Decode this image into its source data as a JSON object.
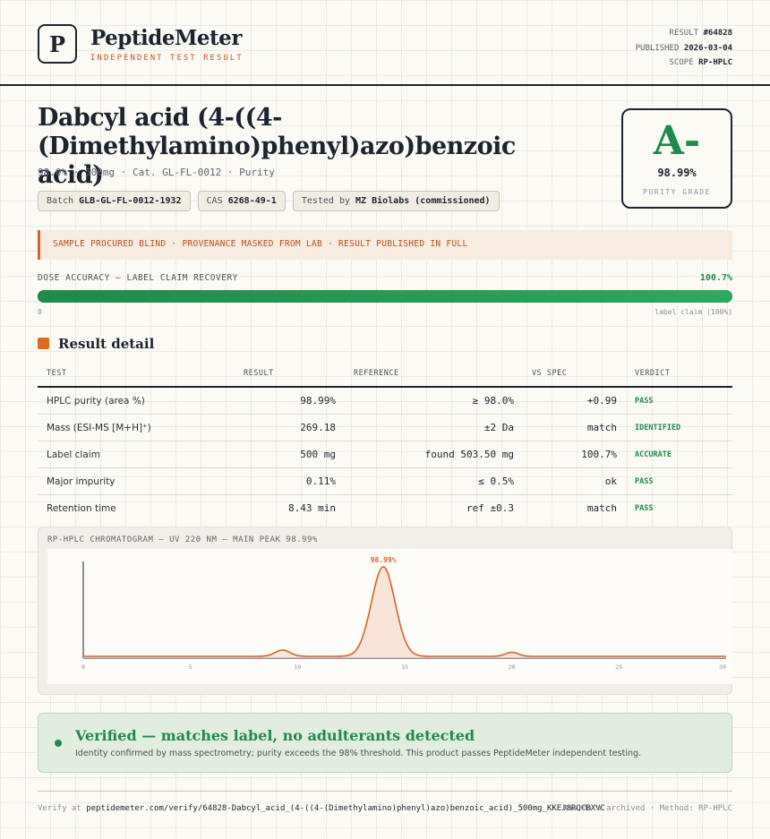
{
  "header": {
    "logo_letter": "P",
    "brand": "PeptideMeter",
    "tagline": "INDEPENDENT TEST RESULT",
    "result_label": "RESULT",
    "result_value": "#64828",
    "published_label": "PUBLISHED",
    "published_value": "2026-03-04",
    "scope_label": "SCOPE",
    "scope_value": "RP-HPLC"
  },
  "product": {
    "title": "Dabcyl acid (4-((4-(Dimethylamino)phenyl)azo)benzoic acid)",
    "subtitle": "98.0% · 500mg · Cat. GL-FL-0012 · Purity",
    "chips": [
      {
        "label": "Batch",
        "value": "GLB-GL-FL-0012-1932"
      },
      {
        "label": "CAS",
        "value": "6268-49-1"
      },
      {
        "label": "Tested by",
        "value": "MZ Biolabs (commissioned)"
      }
    ]
  },
  "grade": {
    "letter": "A-",
    "value": "98.99%",
    "label": "PURITY GRADE",
    "color": "#1f8a4a"
  },
  "notice": "SAMPLE PROCURED BLIND · PROVENANCE MASKED FROM LAB · RESULT PUBLISHED IN FULL",
  "dose": {
    "label": "DOSE ACCURACY — LABEL CLAIM RECOVERY",
    "value": "100.7%",
    "fill_fraction": 1.0,
    "min_label": "0",
    "max_label": "label claim (100%)"
  },
  "section_title": "Result detail",
  "table": {
    "headers": [
      "TEST",
      "RESULT",
      "REFERENCE",
      "VS SPEC",
      "VERDICT"
    ],
    "rows": [
      {
        "test": "HPLC purity (area %)",
        "result": "98.99%",
        "reference": "≥ 98.0%",
        "vs_spec": "+0.99",
        "verdict": "PASS"
      },
      {
        "test": "Mass (ESI-MS [M+H]⁺)",
        "result": "269.18",
        "reference": "±2 Da",
        "vs_spec": "match",
        "verdict": "IDENTIFIED"
      },
      {
        "test": "Label claim",
        "result": "500 mg",
        "reference": "found 503.50 mg",
        "vs_spec": "100.7%",
        "verdict": "ACCURATE"
      },
      {
        "test": "Major impurity",
        "result": "0.11%",
        "reference": "≤ 0.5%",
        "vs_spec": "ok",
        "verdict": "PASS"
      },
      {
        "test": "Retention time",
        "result": "8.43 min",
        "reference": "ref ±0.3",
        "vs_spec": "match",
        "verdict": "PASS"
      }
    ]
  },
  "chromatogram": {
    "title": "RP-HPLC CHROMATOGRAM — UV 220 NM — MAIN PEAK 98.99%",
    "peak_label": "98.99%"
  },
  "chart_data": {
    "type": "line",
    "title": "RP-HPLC CHROMATOGRAM — UV 220 NM — MAIN PEAK 98.99%",
    "xlabel": "",
    "ylabel": "",
    "x_ticks": [
      "0",
      "5",
      "10",
      "15",
      "20",
      "25",
      "30"
    ],
    "xlim": [
      0,
      30
    ],
    "ylim": [
      0,
      1.08
    ],
    "peaks": [
      {
        "center": 9.3,
        "height": 0.07,
        "width": 0.35
      },
      {
        "center": 14.0,
        "height": 1.0,
        "width": 0.55
      },
      {
        "center": 20.0,
        "height": 0.045,
        "width": 0.3
      }
    ],
    "baseline": 0.02,
    "annotations": [
      {
        "x": 14.0,
        "text": "98.99%"
      }
    ],
    "color": "#d2632b"
  },
  "verified": {
    "title": "Verified — matches label, no adulterants detected",
    "subtitle": "Identity confirmed by mass spectrometry; purity exceeds the 98% threshold. This product passes PeptideMeter independent testing."
  },
  "footer": {
    "verify_prefix": "Verify at",
    "verify_url": "peptidemeter.com/verify/64828-Dabcyl_acid_(4-((4-(Dimethylamino)phenyl)azo)benzoic_acid)_500mg_KKEJ8RQCBXVC",
    "right": "Raw data archived · Method: RP-HPLC"
  }
}
